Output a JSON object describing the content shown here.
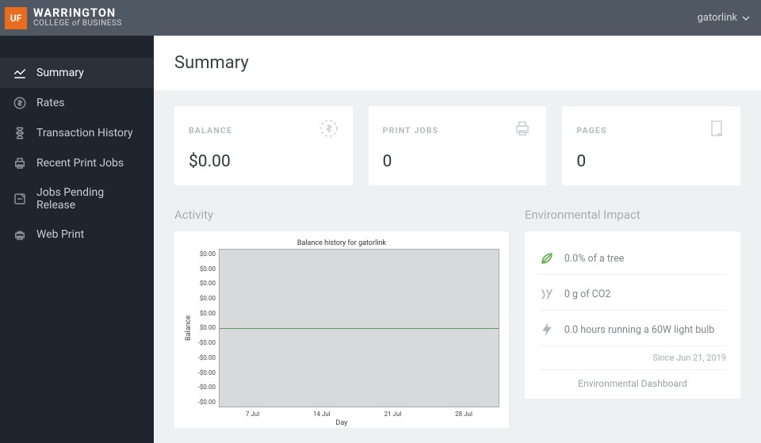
{
  "header": {
    "logo_top": "WARRINGTON",
    "logo_bottom_pre": "COLLEGE ",
    "logo_bottom_of": "of",
    "logo_bottom_post": " BUSINESS",
    "uf": "UF",
    "user": "gatorlink"
  },
  "sidebar": {
    "items": [
      {
        "label": "Summary"
      },
      {
        "label": "Rates"
      },
      {
        "label": "Transaction History"
      },
      {
        "label": "Recent Print Jobs"
      },
      {
        "label": "Jobs Pending Release"
      },
      {
        "label": "Web Print"
      }
    ]
  },
  "page": {
    "title": "Summary"
  },
  "stats": {
    "balance": {
      "label": "BALANCE",
      "value": "$0.00"
    },
    "printjobs": {
      "label": "PRINT JOBS",
      "value": "0"
    },
    "pages": {
      "label": "PAGES",
      "value": "0"
    }
  },
  "activity": {
    "title": "Activity"
  },
  "env": {
    "title": "Environmental Impact",
    "tree": "0.0% of a tree",
    "co2": "0 g of CO2",
    "bulb": "0.0 hours running a 60W light bulb",
    "since": "Since Jun 21, 2019",
    "link": "Environmental Dashboard"
  },
  "chart_data": {
    "type": "line",
    "title": "Balance history for gatorlink",
    "xlabel": "Day",
    "ylabel": "Balance",
    "ylim": [
      -0.0,
      0.0
    ],
    "y_ticks": [
      "$0.00",
      "$0.00",
      "$0.00",
      "$0.00",
      "$0.00",
      "$0.00",
      "-$0.00",
      "-$0.00",
      "-$0.00",
      "-$0.00",
      "-$0.00"
    ],
    "x_ticks": [
      "7 Jul",
      "14 Jul",
      "21 Jul",
      "28 Jul"
    ],
    "series": [
      {
        "name": "Balance",
        "values": [
          0,
          0,
          0,
          0,
          0,
          0,
          0,
          0,
          0,
          0,
          0,
          0,
          0,
          0,
          0,
          0,
          0,
          0,
          0,
          0,
          0,
          0,
          0,
          0,
          0,
          0,
          0,
          0
        ]
      }
    ]
  }
}
